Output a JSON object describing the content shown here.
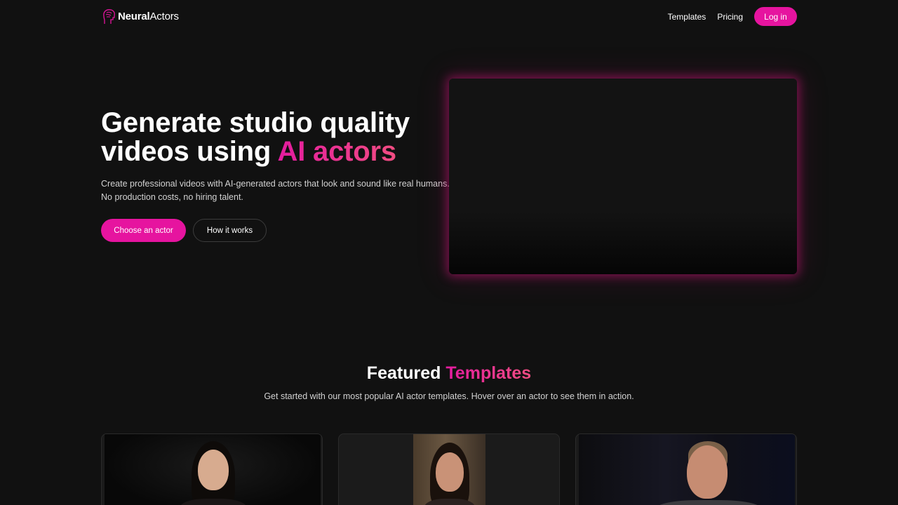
{
  "brand": {
    "name_bold": "Neural",
    "name_regular": "Actors",
    "accent_color": "#e6149f"
  },
  "nav": {
    "templates": "Templates",
    "pricing": "Pricing",
    "login": "Log in"
  },
  "hero": {
    "title_line1": "Generate studio quality",
    "title_line2_plain": "videos using",
    "title_highlight": "AI actors",
    "subtitle": "Create professional videos with AI-generated actors that look and sound like real humans. No production costs, no hiring talent.",
    "primary_cta": "Choose an actor",
    "secondary_cta": "How it works"
  },
  "featured": {
    "title_plain": "Featured",
    "title_highlight": "Templates",
    "subtitle": "Get started with our most popular AI actor templates. Hover over an actor to see them in action.",
    "cards": [
      {
        "actor": "woman-dark-hair"
      },
      {
        "actor": "young-woman-room"
      },
      {
        "actor": "older-man"
      }
    ]
  }
}
